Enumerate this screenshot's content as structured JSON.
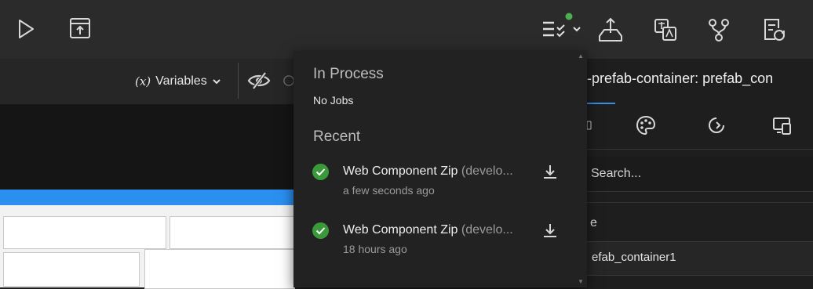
{
  "toolbar": {
    "icons": [
      "play-icon",
      "publish-icon",
      "jobs-icon",
      "deploy-icon",
      "translate-icon",
      "branch-icon",
      "compare-icon"
    ],
    "jobs_indicator_color": "#4cae4c"
  },
  "subbar": {
    "variables_symbol": "(x)",
    "variables_label": "Variables"
  },
  "right_panel": {
    "title": "-prefab-container: prefab_con",
    "search_placeholder": "Search...",
    "property_label": "e",
    "property_value": "efab_container1"
  },
  "jobs_popover": {
    "in_process_heading": "In Process",
    "in_process_empty": "No Jobs",
    "recent_heading": "Recent",
    "jobs": [
      {
        "name": "Web Component Zip",
        "detail": "(develo...",
        "time": "a few seconds ago",
        "status": "success"
      },
      {
        "name": "Web Component Zip",
        "detail": "(develo...",
        "time": "18 hours ago",
        "status": "success"
      }
    ]
  },
  "colors": {
    "accent": "#2b8ff0",
    "success": "#3a9a3a",
    "panel_bg": "#222222"
  }
}
